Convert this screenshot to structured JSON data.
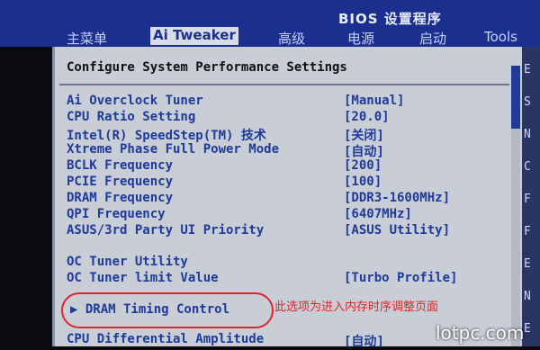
{
  "window": {
    "title": "BIOS 设置程序"
  },
  "tabs": [
    {
      "label": "主菜单"
    },
    {
      "label": "Ai Tweaker"
    },
    {
      "label": "高级"
    },
    {
      "label": "电源"
    },
    {
      "label": "启动"
    },
    {
      "label": "Tools"
    }
  ],
  "panel": {
    "heading": "Configure System Performance Settings"
  },
  "settings": [
    {
      "label": "Ai Overclock Tuner",
      "value": "[Manual]"
    },
    {
      "label": "CPU Ratio Setting",
      "value": "[20.0]"
    },
    {
      "label": "Intel(R) SpeedStep(TM) 技术",
      "value": "[关闭]"
    },
    {
      "label": "Xtreme Phase Full Power Mode",
      "value": "[自动]"
    },
    {
      "label": "BCLK Frequency",
      "value": "[200]"
    },
    {
      "label": "PCIE Frequency",
      "value": "[100]"
    },
    {
      "label": "DRAM Frequency",
      "value": "[DDR3-1600MHz]"
    },
    {
      "label": "QPI Frequency",
      "value": "[6407MHz]"
    },
    {
      "label": "ASUS/3rd Party UI Priority",
      "value": "[ASUS Utility]"
    }
  ],
  "oc": [
    {
      "label": "OC Tuner Utility",
      "value": ""
    },
    {
      "label": "OC Tuner limit Value",
      "value": "[Turbo Profile]"
    }
  ],
  "submenu": {
    "label": "▶ DRAM Timing Control"
  },
  "annotation": {
    "text": "此选项为进入内存时序调整页面"
  },
  "bottom_row": {
    "label": "CPU Differential Amplitude",
    "value": "[自动]"
  },
  "right_edge": [
    "E",
    "S",
    "N",
    "C",
    "F",
    "F",
    "E",
    "N",
    "E"
  ],
  "watermark": {
    "text": "lotpc.com"
  },
  "colors": {
    "header_blue": "#1b2f8f",
    "item_blue": "#1e3a9a",
    "annotation_red": "#e0242a"
  }
}
